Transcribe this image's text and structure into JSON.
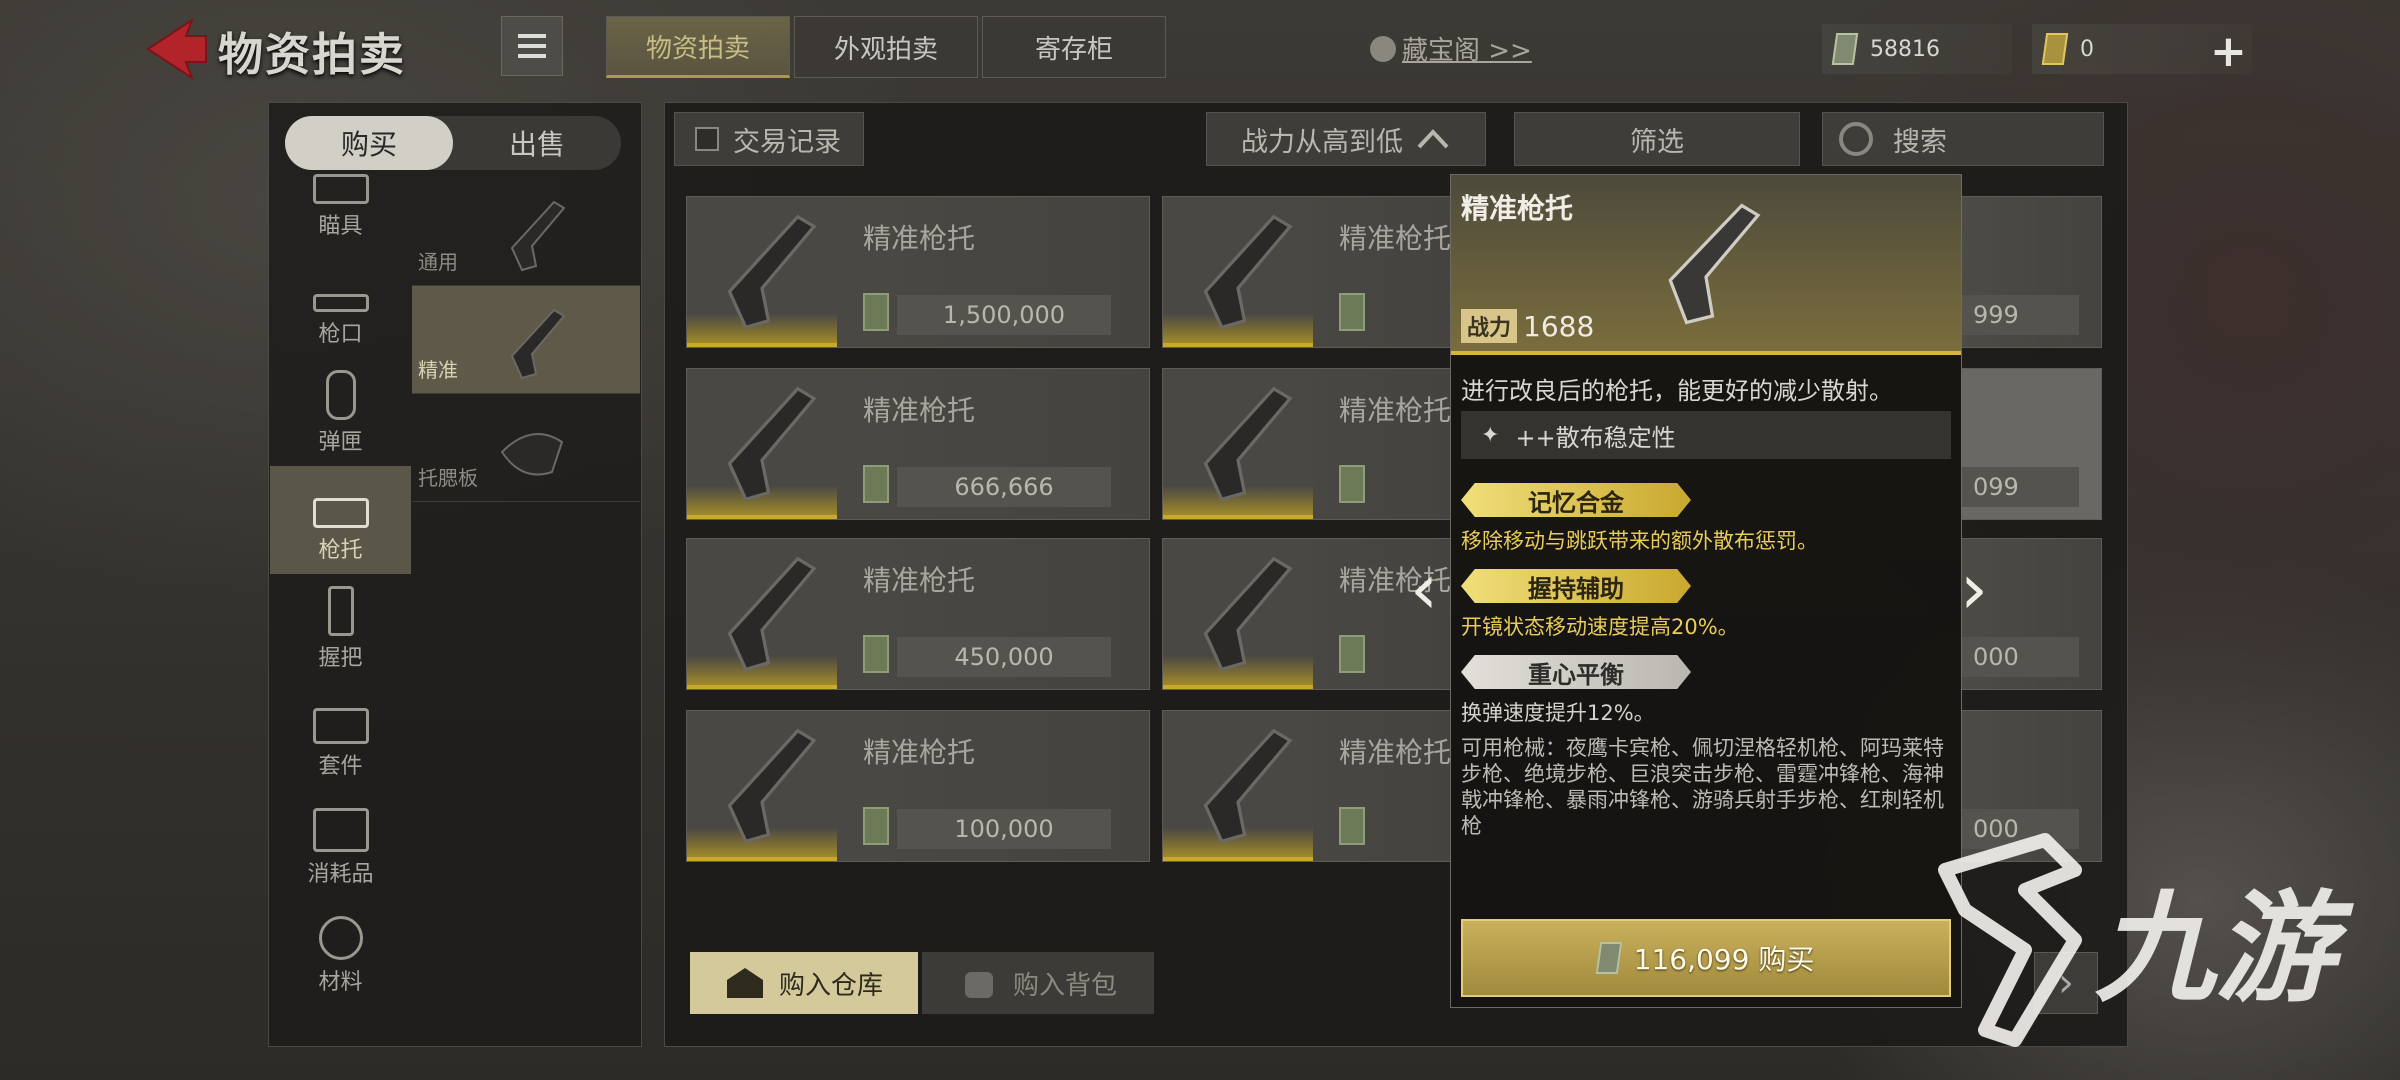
{
  "header": {
    "title": "物资拍卖",
    "tabs": [
      "物资拍卖",
      "外观拍卖",
      "寄存柜"
    ],
    "treasure_link": "藏宝阁 >>",
    "currency_money": "58816",
    "currency_ticket": "0"
  },
  "left": {
    "buy_label": "购买",
    "sell_label": "出售",
    "categories": [
      {
        "label": "瞄具",
        "icon": "scope-icon"
      },
      {
        "label": "枪口",
        "icon": "muzzle-icon"
      },
      {
        "label": "弹匣",
        "icon": "magazine-icon"
      },
      {
        "label": "枪托",
        "icon": "stock-icon"
      },
      {
        "label": "握把",
        "icon": "grip-icon"
      },
      {
        "label": "套件",
        "icon": "kit-icon"
      },
      {
        "label": "消耗品",
        "icon": "consumable-icon"
      },
      {
        "label": "材料",
        "icon": "material-icon"
      },
      {
        "label": "",
        "icon": "misc-icon"
      }
    ],
    "subcategories": [
      {
        "label": "通用"
      },
      {
        "label": "精准"
      },
      {
        "label": "托腮板"
      }
    ]
  },
  "toolbar": {
    "record_label": "交易记录",
    "sort_label": "战力从高到低",
    "filter_label": "筛选",
    "search_label": "搜索"
  },
  "listings": [
    {
      "name": "精准枪托",
      "price": "1,500,000"
    },
    {
      "name": "精准枪托",
      "price": "666,666"
    },
    {
      "name": "精准枪托",
      "price": "450,000"
    },
    {
      "name": "精准枪托",
      "price": "100,000"
    }
  ],
  "listings_col2": [
    {
      "name": "精准枪托"
    },
    {
      "name": "精准枪托"
    },
    {
      "name": "精准枪托"
    },
    {
      "name": "精准枪托"
    }
  ],
  "listings_col3_prices": [
    "999",
    "099",
    "000",
    "000"
  ],
  "popup": {
    "title": "精准枪托",
    "power_tag": "战力",
    "power": "1688",
    "description": "进行改良后的枪托，能更好的减少散射。",
    "stat": "++散布稳定性",
    "perks": [
      {
        "name": "记忆合金",
        "desc": "移除移动与跳跃带来的额外散布惩罚。",
        "tier": "gold"
      },
      {
        "name": "握持辅助",
        "desc": "开镜状态移动速度提高20%。",
        "tier": "gold"
      },
      {
        "name": "重心平衡",
        "desc": "换弹速度提升12%。",
        "tier": "grey"
      }
    ],
    "compatible_guns": "可用枪械：夜鹰卡宾枪、佩切涅格轻机枪、阿玛莱特步枪、绝境步枪、巨浪突击步枪、雷霆冲锋枪、海神戟冲锋枪、暴雨冲锋枪、游骑兵射手步枪、红刺轻机枪",
    "buy_label": "116,099 购买"
  },
  "bottom": {
    "warehouse_label": "购入仓库",
    "backpack_label": "购入背包"
  },
  "watermark": "九游",
  "colors": {
    "accent_gold": "#d7b53c",
    "panel": "#1c1b19"
  }
}
